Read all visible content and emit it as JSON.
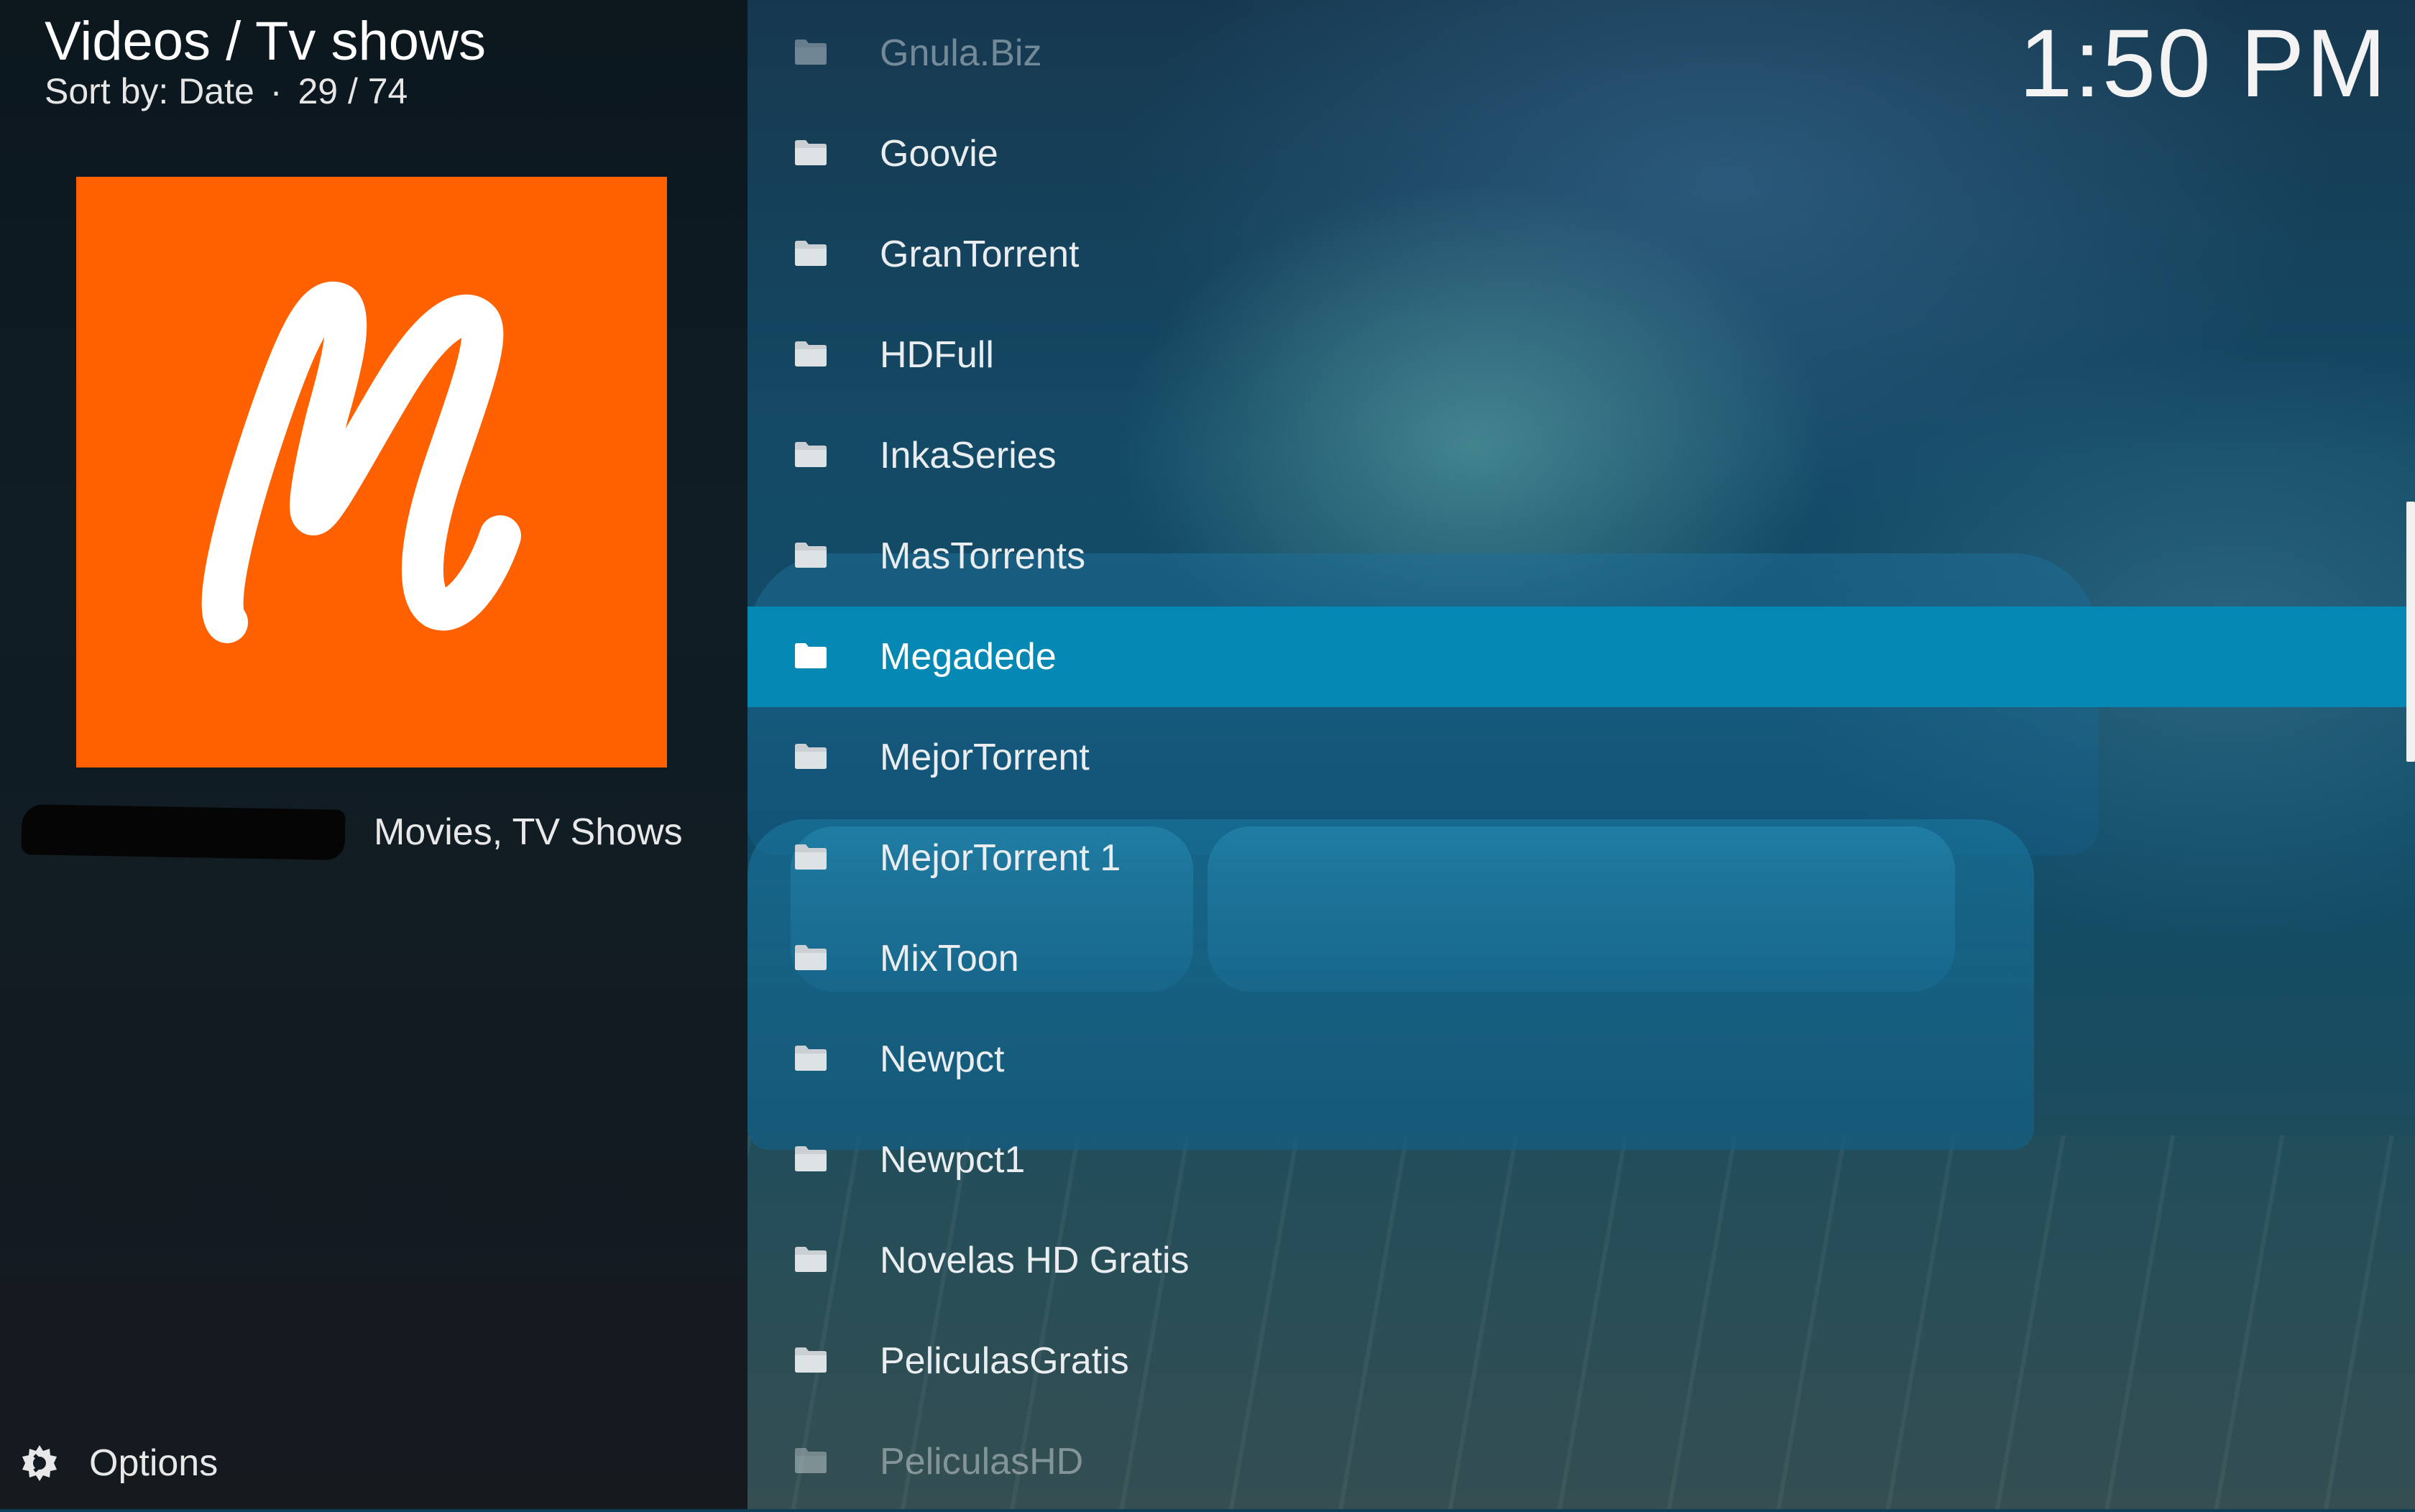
{
  "header": {
    "title": "Videos / Tv shows",
    "sort_label": "Sort by: Date",
    "separator": "·",
    "position": "29 / 74"
  },
  "clock": "1:50 PM",
  "info_panel": {
    "thumbnail_letter": "M",
    "thumbnail_color": "#ff6000",
    "genres": "Movies, TV Shows"
  },
  "options": {
    "label": "Options",
    "icon": "options-gear-icon"
  },
  "list": {
    "selected_color": "#0688b4",
    "items": [
      {
        "label": "Gnula.Biz",
        "state": "faded"
      },
      {
        "label": "Goovie",
        "state": "normal"
      },
      {
        "label": "GranTorrent",
        "state": "normal"
      },
      {
        "label": "HDFull",
        "state": "normal"
      },
      {
        "label": "InkaSeries",
        "state": "normal"
      },
      {
        "label": "MasTorrents",
        "state": "normal"
      },
      {
        "label": "Megadede",
        "state": "selected"
      },
      {
        "label": "MejorTorrent",
        "state": "normal"
      },
      {
        "label": "MejorTorrent 1",
        "state": "normal"
      },
      {
        "label": "MixToon",
        "state": "normal"
      },
      {
        "label": "Newpct",
        "state": "normal"
      },
      {
        "label": "Newpct1",
        "state": "normal"
      },
      {
        "label": "Novelas HD Gratis",
        "state": "normal"
      },
      {
        "label": "PeliculasGratis",
        "state": "normal"
      },
      {
        "label": "PeliculasHD",
        "state": "faded"
      }
    ]
  }
}
